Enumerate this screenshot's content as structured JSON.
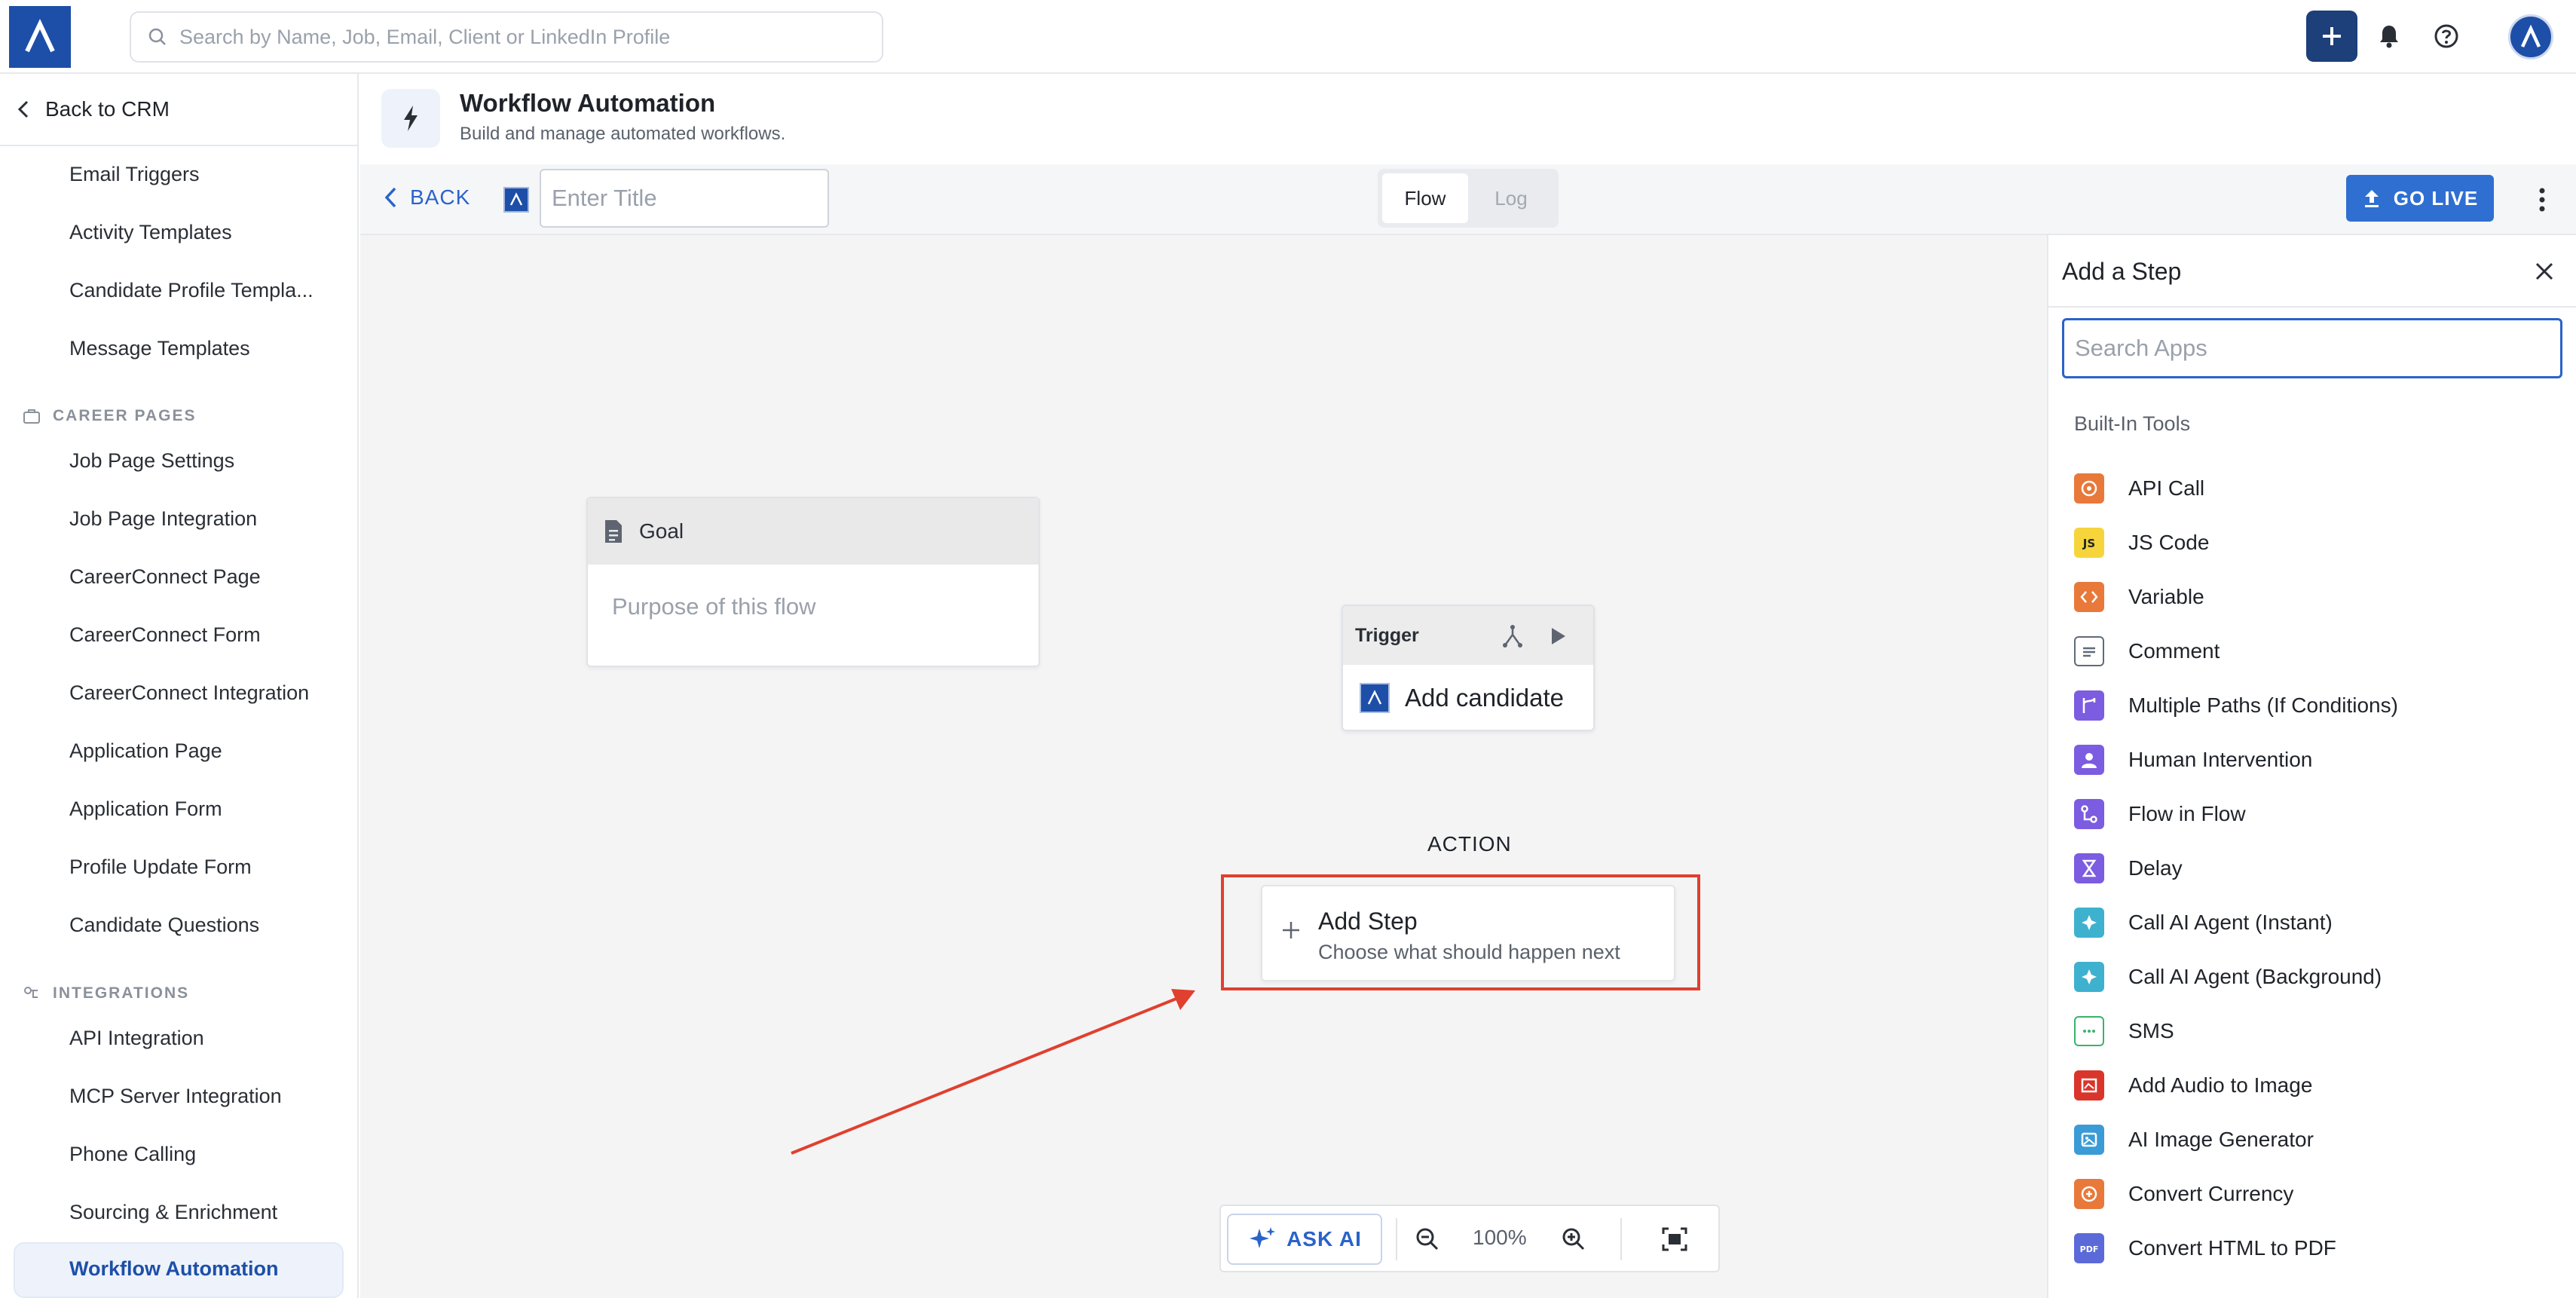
{
  "search": {
    "placeholder": "Search by Name, Job, Email, Client or LinkedIn Profile"
  },
  "sidebar": {
    "back_label": "Back to CRM",
    "items_top": [
      "Email Triggers",
      "Activity Templates",
      "Candidate Profile Templa...",
      "Message Templates"
    ],
    "section_career": "CAREER PAGES",
    "items_career": [
      "Job Page Settings",
      "Job Page Integration",
      "CareerConnect Page",
      "CareerConnect Form",
      "CareerConnect Integration",
      "Application Page",
      "Application Form",
      "Profile Update Form",
      "Candidate Questions"
    ],
    "section_integrations": "INTEGRATIONS",
    "items_integrations": [
      "API Integration",
      "MCP Server Integration",
      "Phone Calling",
      "Sourcing & Enrichment"
    ],
    "active_item": "Workflow Automation"
  },
  "header": {
    "title": "Workflow Automation",
    "subtitle": "Build and manage automated workflows."
  },
  "toolbar": {
    "back_label": "BACK",
    "title_placeholder": "Enter Title",
    "tab_flow": "Flow",
    "tab_log": "Log",
    "go_live_label": "GO LIVE"
  },
  "canvas": {
    "goal_title": "Goal",
    "goal_placeholder": "Purpose of this flow",
    "trigger_title": "Trigger",
    "trigger_value": "Add candidate",
    "action_label": "ACTION",
    "add_step_title": "Add Step",
    "add_step_subtitle": "Choose what should happen next",
    "ask_ai_label": "ASK AI",
    "zoom_level": "100%"
  },
  "panel": {
    "title": "Add a Step",
    "search_placeholder": "Search Apps",
    "section_title": "Built-In Tools",
    "tools": [
      {
        "label": "API Call",
        "icon": "api-icon",
        "color": "#e8793a"
      },
      {
        "label": "JS Code",
        "icon": "js-icon",
        "color": "#f5d53b"
      },
      {
        "label": "Variable",
        "icon": "code-brackets-icon",
        "color": "#e8793a"
      },
      {
        "label": "Comment",
        "icon": "comment-icon",
        "color": "#5f6b78"
      },
      {
        "label": "Multiple Paths (If Conditions)",
        "icon": "branch-icon",
        "color": "#7c5ce0"
      },
      {
        "label": "Human Intervention",
        "icon": "person-icon",
        "color": "#7c5ce0"
      },
      {
        "label": "Flow in Flow",
        "icon": "flow-icon",
        "color": "#7c5ce0"
      },
      {
        "label": "Delay",
        "icon": "hourglass-icon",
        "color": "#7c5ce0"
      },
      {
        "label": "Call AI Agent (Instant)",
        "icon": "ai-agent-icon",
        "color": "#3eb1cf"
      },
      {
        "label": "Call AI Agent (Background)",
        "icon": "ai-agent-icon",
        "color": "#3eb1cf"
      },
      {
        "label": "SMS",
        "icon": "sms-icon",
        "color": "#3bb36b"
      },
      {
        "label": "Add Audio to Image",
        "icon": "audio-image-icon",
        "color": "#d9352b"
      },
      {
        "label": "AI Image Generator",
        "icon": "image-generator-icon",
        "color": "#3a9bd6"
      },
      {
        "label": "Convert Currency",
        "icon": "currency-icon",
        "color": "#e8793a"
      },
      {
        "label": "Convert HTML to PDF",
        "icon": "pdf-icon",
        "color": "#5b6ad8"
      }
    ]
  },
  "colors": {
    "brand": "#1d4fa8",
    "accent": "#2a63c9",
    "highlight": "#e0402e"
  }
}
